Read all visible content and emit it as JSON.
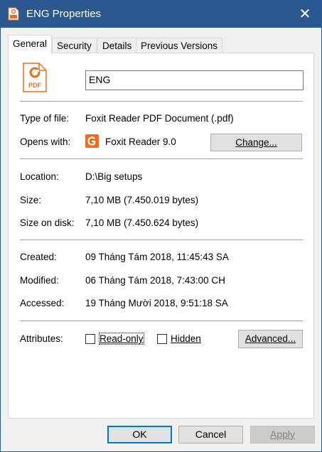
{
  "window": {
    "title": "ENG Properties",
    "close_glyph": "✕"
  },
  "tabs": [
    {
      "label": "General",
      "active": true
    },
    {
      "label": "Security",
      "active": false
    },
    {
      "label": "Details",
      "active": false
    },
    {
      "label": "Previous Versions",
      "active": false
    }
  ],
  "file": {
    "icon": "pdf-file-icon",
    "icon_text": "PDF",
    "name": "ENG"
  },
  "info": {
    "type_label": "Type of file:",
    "type_value": "Foxit Reader PDF Document (.pdf)",
    "opens_label": "Opens with:",
    "opens_value": "Foxit Reader 9.0",
    "opens_icon": "foxit-reader-icon",
    "change_label": "Change...",
    "location_label": "Location:",
    "location_value": "D:\\Big setups",
    "size_label": "Size:",
    "size_value": "7,10 MB (7.450.019 bytes)",
    "size_disk_label": "Size on disk:",
    "size_disk_value": "7,10 MB (7.450.624 bytes)",
    "created_label": "Created:",
    "created_value": "09 Tháng Tám 2018, 11:45:43 SA",
    "modified_label": "Modified:",
    "modified_value": "06 Tháng Tám 2018, 7:43:00 CH",
    "accessed_label": "Accessed:",
    "accessed_value": "19 Tháng Mười 2018, 9:51:18 SA"
  },
  "attributes": {
    "label": "Attributes:",
    "readonly_label": "Read-only",
    "readonly_checked": false,
    "hidden_label": "Hidden",
    "hidden_checked": false,
    "advanced_label": "Advanced..."
  },
  "buttons": {
    "ok": "OK",
    "cancel": "Cancel",
    "apply": "Apply"
  },
  "colors": {
    "titlebar": "#2c5890",
    "accent": "#0078d7",
    "foxit_orange": "#f26b1d"
  }
}
